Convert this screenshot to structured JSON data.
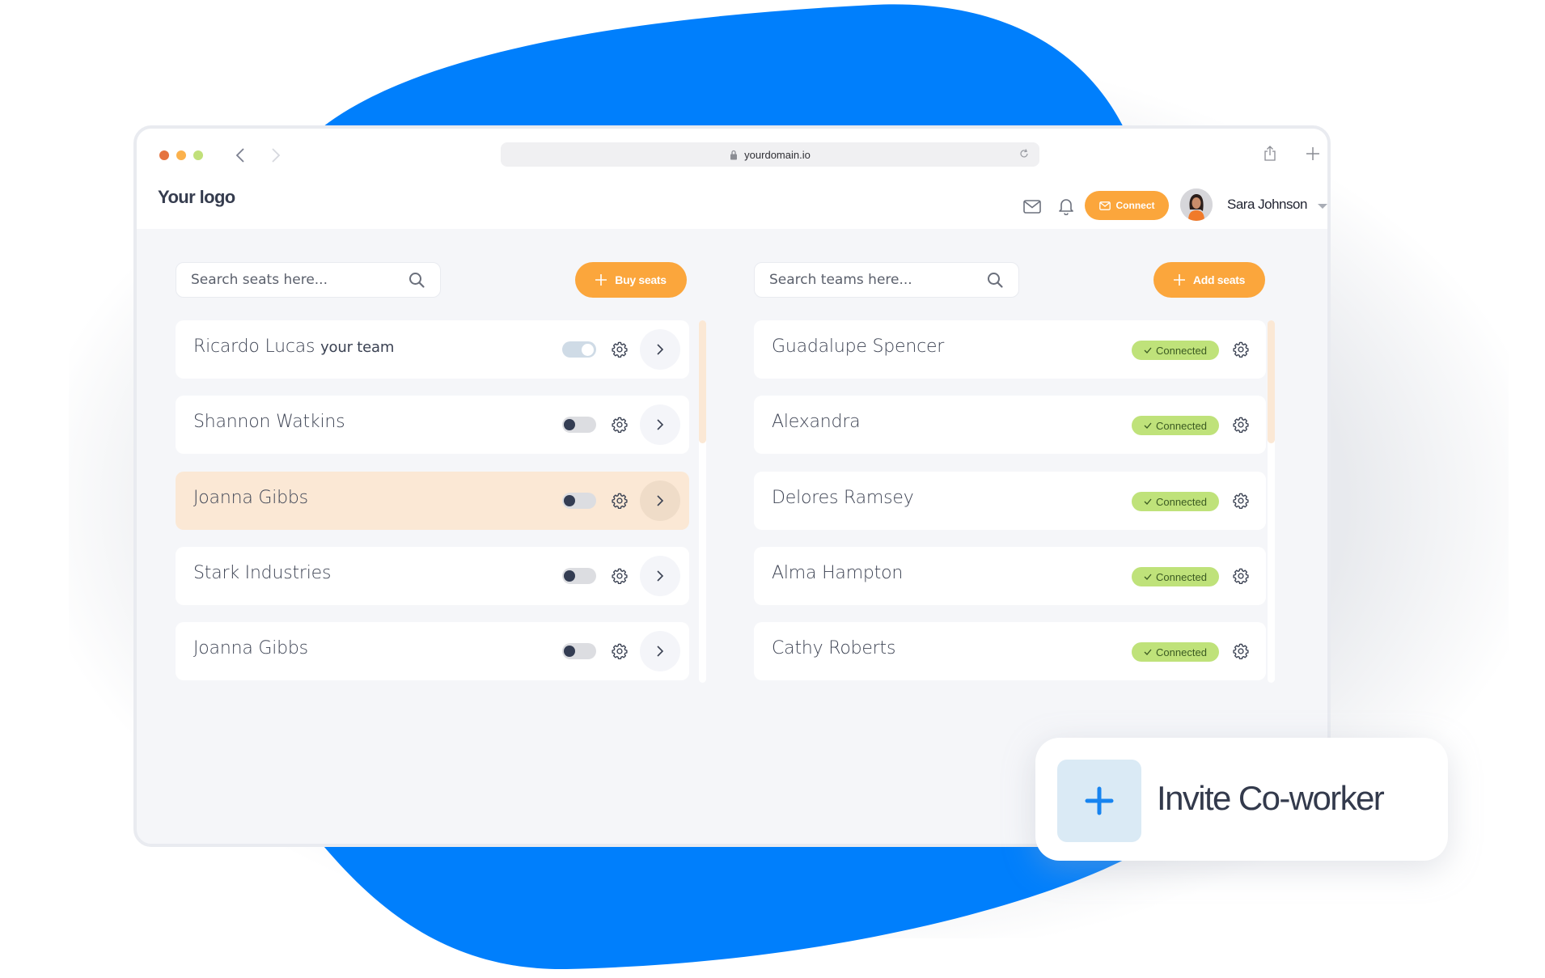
{
  "colors": {
    "accent_blue": "#007ffc",
    "accent_orange": "#fba63c",
    "selected_row": "#fbe8d5",
    "connected_green": "#bfe27a",
    "traffic_red": "#e5733f",
    "traffic_yellow": "#fbb14c",
    "traffic_green": "#c1e07a"
  },
  "browser": {
    "url": "yourdomain.io",
    "icons": [
      "back-icon",
      "forward-icon",
      "lock-icon",
      "reload-icon",
      "share-icon",
      "new-tab-icon"
    ]
  },
  "header": {
    "logo": "Your logo",
    "icons": [
      "mail-icon",
      "bell-icon"
    ],
    "connect_label": "Connect",
    "user_name": "Sara Johnson"
  },
  "seats": {
    "search_placeholder": "Search seats here...",
    "buy_label": "Buy seats",
    "rows": [
      {
        "name": "Ricardo Lucas",
        "sub": "your team",
        "toggle": "on",
        "selected": false
      },
      {
        "name": "Shannon Watkins",
        "sub": "",
        "toggle": "off",
        "selected": false
      },
      {
        "name": "Joanna Gibbs",
        "sub": "",
        "toggle": "off",
        "selected": true
      },
      {
        "name": "Stark Industries",
        "sub": "",
        "toggle": "off",
        "selected": false
      },
      {
        "name": "Joanna Gibbs",
        "sub": "",
        "toggle": "off",
        "selected": false
      }
    ]
  },
  "teams": {
    "search_placeholder": "Search teams here...",
    "add_label": "Add seats",
    "rows": [
      {
        "name": "Guadalupe Spencer",
        "status": "Connected"
      },
      {
        "name": "Alexandra",
        "status": "Connected"
      },
      {
        "name": "Delores Ramsey",
        "status": "Connected"
      },
      {
        "name": "Alma Hampton",
        "status": "Connected"
      },
      {
        "name": "Cathy Roberts",
        "status": "Connected"
      }
    ]
  },
  "invite": {
    "label": "Invite Co-worker"
  }
}
